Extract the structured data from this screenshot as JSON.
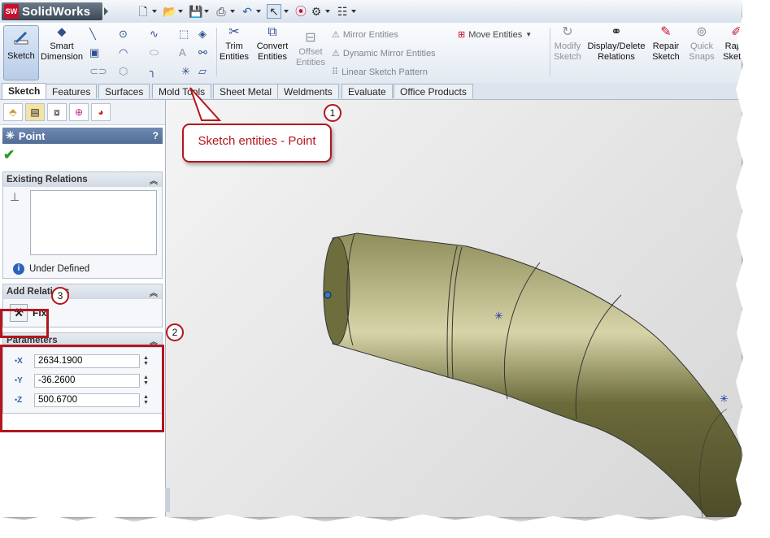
{
  "app": {
    "name": "SolidWorks",
    "logo_badge": "SW"
  },
  "quick_access": {
    "icons": [
      "new-document-icon",
      "open-folder-icon",
      "save-icon",
      "print-icon",
      "undo-icon",
      "select-pointer-icon",
      "traffic-light-icon",
      "options-icon",
      "list-icon"
    ]
  },
  "command_manager": {
    "sketch": "Sketch",
    "smart_dimension": "Smart Dimension",
    "trim_entities": "Trim Entities",
    "convert_entities": "Convert Entities",
    "offset_entities": "Offset Entities",
    "mirror_entities": "Mirror Entities",
    "dynamic_mirror_entities": "Dynamic Mirror Entities",
    "linear_sketch_pattern": "Linear Sketch Pattern",
    "move_entities": "Move Entities",
    "modify_sketch": "Modify Sketch",
    "display_delete_relations": "Display/Delete Relations",
    "repair_sketch": "Repair Sketch",
    "quick_snaps": "Quick Snaps",
    "rapid_sketch": "Rapid Sketch"
  },
  "tabs": [
    "Sketch",
    "Features",
    "Surfaces",
    "Mold Tools",
    "Sheet Metal",
    "Weldments",
    "Evaluate",
    "Office Products"
  ],
  "property_manager": {
    "title": "Point",
    "help": "?",
    "existing_relations": {
      "title": "Existing Relations",
      "status": "Under Defined"
    },
    "add_relations": {
      "title": "Add Relations",
      "fix_label": "Fix"
    },
    "parameters": {
      "title": "Parameters",
      "x": "2634.1900",
      "y": "-36.2600",
      "z": "500.6700",
      "x_label": "X",
      "y_label": "Y",
      "z_label": "Z"
    }
  },
  "callouts": {
    "main_label": "Sketch entities - Point",
    "n1": "1",
    "n2": "2",
    "n3": "3"
  },
  "colors": {
    "accent_red": "#b3161d",
    "model": "#6b6a3a",
    "header_blue": "#5f7ba4"
  }
}
